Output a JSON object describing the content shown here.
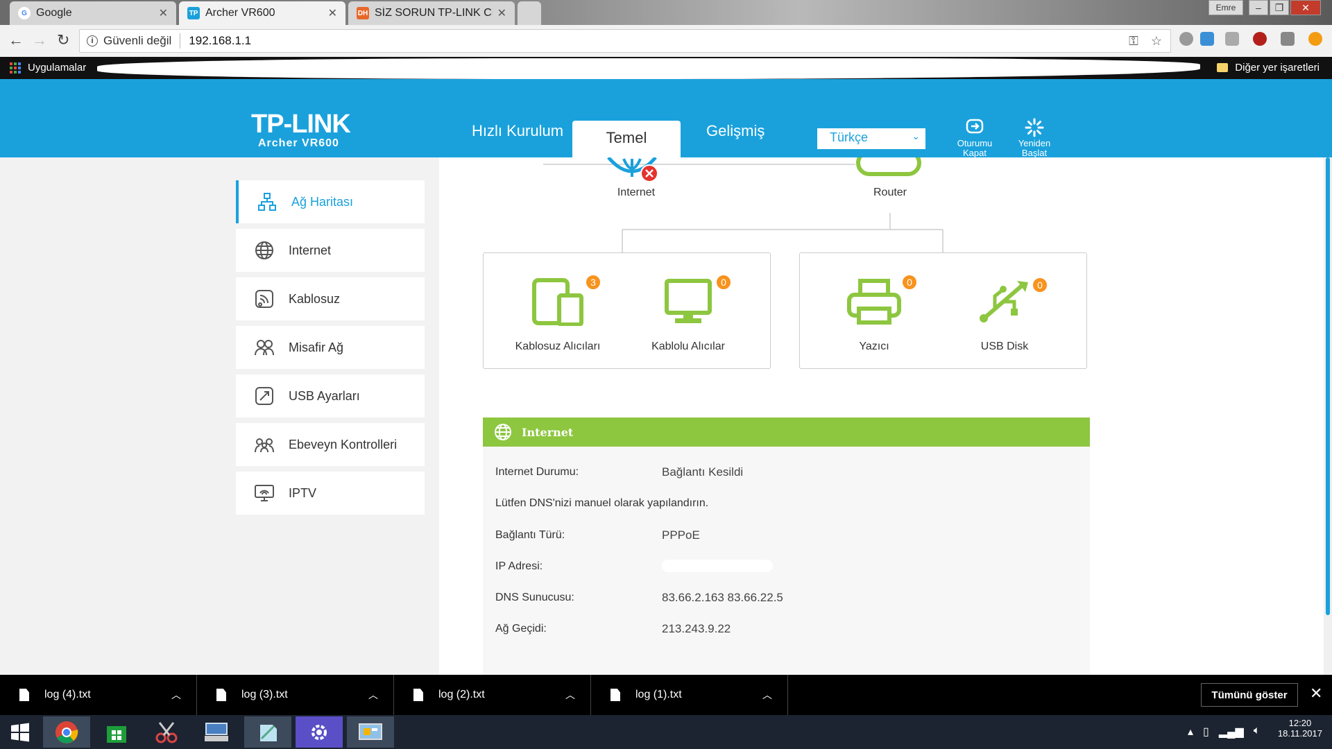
{
  "browser": {
    "tabs": [
      {
        "title": "Google",
        "favicon": "G",
        "color": "#4285f4"
      },
      {
        "title": "Archer VR600",
        "favicon": "TP",
        "color": "#1aa1dc"
      },
      {
        "title": "SİZ SORUN TP-LINK CEV",
        "favicon": "DH",
        "color": "#e8672a"
      }
    ],
    "user_badge": "Emre",
    "security_label": "Güvenli değil",
    "url": "192.168.1.1",
    "bookmarks": {
      "apps_label": "Uygulamalar",
      "other_label": "Diğer yer işaretleri"
    }
  },
  "router": {
    "brand": "TP-LINK",
    "model": "Archer VR600",
    "nav": {
      "quick": "Hızlı Kurulum",
      "basic": "Temel",
      "advanced": "Gelişmiş"
    },
    "language": "Türkçe",
    "logout": "Oturumu Kapat",
    "reboot": "Yeniden Başlat"
  },
  "sidebar": {
    "items": [
      {
        "label": "Ağ Haritası",
        "icon": "network-map-icon"
      },
      {
        "label": "Internet",
        "icon": "globe-icon"
      },
      {
        "label": "Kablosuz",
        "icon": "wireless-icon"
      },
      {
        "label": "Misafir Ağ",
        "icon": "guest-icon"
      },
      {
        "label": "USB Ayarları",
        "icon": "usb-settings-icon"
      },
      {
        "label": "Ebeveyn Kontrolleri",
        "icon": "parental-icon"
      },
      {
        "label": "IPTV",
        "icon": "iptv-icon"
      }
    ]
  },
  "map": {
    "internet_label": "Internet",
    "router_label": "Router",
    "devices": [
      {
        "label": "Kablosuz Alıcıları",
        "count": "3"
      },
      {
        "label": "Kablolu Alıcılar",
        "count": "0"
      },
      {
        "label": "Yazıcı",
        "count": "0"
      },
      {
        "label": "USB Disk",
        "count": "0"
      }
    ]
  },
  "internet_panel": {
    "title": "Internet",
    "status_label": "Internet Durumu:",
    "status_value": "Bağlantı Kesildi",
    "dns_hint": "Lütfen DNS'nizi manuel olarak yapılandırın.",
    "conn_type_label": "Bağlantı Türü:",
    "conn_type_value": "PPPoE",
    "ip_label": "IP Adresi:",
    "ip_value": "",
    "dns_label": "DNS Sunucusu:",
    "dns_value": "83.66.2.163 83.66.22.5",
    "gateway_label": "Ağ Geçidi:",
    "gateway_value": "213.243.9.22"
  },
  "downloads": {
    "files": [
      "log (4).txt",
      "log (3).txt",
      "log (2).txt",
      "log (1).txt"
    ],
    "show_all": "Tümünü göster"
  },
  "taskbar": {
    "time": "12:20",
    "date": "18.11.2017"
  },
  "colors": {
    "brand_blue": "#1aa1dc",
    "green": "#8dc63f",
    "badge_orange": "#f7931e",
    "error_red": "#e5322d"
  }
}
